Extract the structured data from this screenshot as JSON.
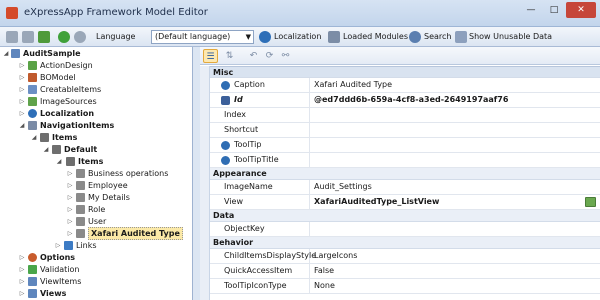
{
  "window": {
    "title": "eXpressApp Framework Model Editor"
  },
  "toolbar": {
    "language_label": "Language",
    "language_value": "(Default language)",
    "localization": "Localization",
    "loaded_modules": "Loaded Modules",
    "search": "Search",
    "show_unusable": "Show Unusable Data"
  },
  "tree": {
    "root": "AuditSample",
    "items": [
      "ActionDesign",
      "BOModel",
      "CreatableItems",
      "ImageSources",
      "Localization",
      "NavigationItems",
      "Items",
      "Default",
      "Items",
      "Business operations",
      "Employee",
      "My Details",
      "Role",
      "User",
      "Xafari Audited Type",
      "Links",
      "Options",
      "Validation",
      "ViewItems",
      "Views"
    ]
  },
  "grid": {
    "cat_misc": "Misc",
    "caption_label": "Caption",
    "caption_value": "Xafari Audited Type",
    "id_label": "Id",
    "id_value": "@ed7ddd6b-659a-4cf8-a3ed-2649197aaf76",
    "index_label": "Index",
    "shortcut_label": "Shortcut",
    "tooltip_label": "ToolTip",
    "tooltiptitle_label": "ToolTipTitle",
    "cat_appearance": "Appearance",
    "imagename_label": "ImageName",
    "imagename_value": "Audit_Settings",
    "view_label": "View",
    "view_value": "XafariAuditedType_ListView",
    "cat_data": "Data",
    "objectkey_label": "ObjectKey",
    "cat_behavior": "Behavior",
    "childitems_label": "ChildItemsDisplayStyle",
    "childitems_value": "LargeIcons",
    "quickaccess_label": "QuickAccessItem",
    "quickaccess_value": "False",
    "tooltipicon_label": "ToolTipIconType",
    "tooltipicon_value": "None"
  }
}
